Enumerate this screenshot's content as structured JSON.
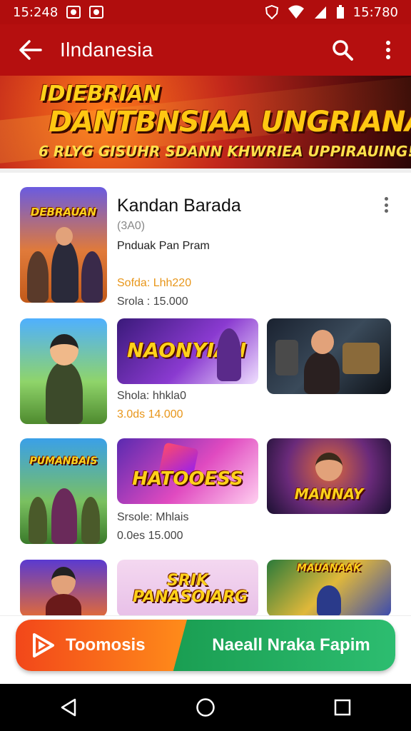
{
  "status_bar": {
    "time": "15:248",
    "clock_right": "15:780"
  },
  "app_bar": {
    "title": "Ilndanesia",
    "back_icon": "arrow-left-icon",
    "search_icon": "search-icon",
    "menu_icon": "more-vert-icon"
  },
  "banner": {
    "line1": "IDIEBRIAN",
    "line2": "DANTBNSIAA UNGRIANAK!",
    "line3": "6 RLYG GISUHR SDANN KHWRIEA UPPIRAUING!"
  },
  "featured": {
    "title": "Kandan Barada",
    "subtitle": "(3A0)",
    "description": "Pnduak Pan Pram",
    "thumb_text": "DEBRAUAN",
    "stat1": "Sofda: Lhh220",
    "stat2": "Srola : 15.000"
  },
  "row2": {
    "card_text": "NAONYIAN",
    "stat1": "Shola: hhkla0",
    "stat2": "3.0ds 14.000"
  },
  "row3": {
    "thumb_text": "PUMANBAIS",
    "card_text": "HATOOESS",
    "right_text": "MANNAY",
    "stat1": "Srsole: Mhlais",
    "stat2": "0.0es 15.000"
  },
  "row4": {
    "card_text": "SRIK PANASOIARG",
    "right_text": "MAUANAAK"
  },
  "cta": {
    "left_label": "Toomosis",
    "right_label": "Naeall Nraka Fapim"
  },
  "colors": {
    "brand_red": "#b50f0f",
    "orange": "#f2471a",
    "green": "#1a9e52"
  }
}
